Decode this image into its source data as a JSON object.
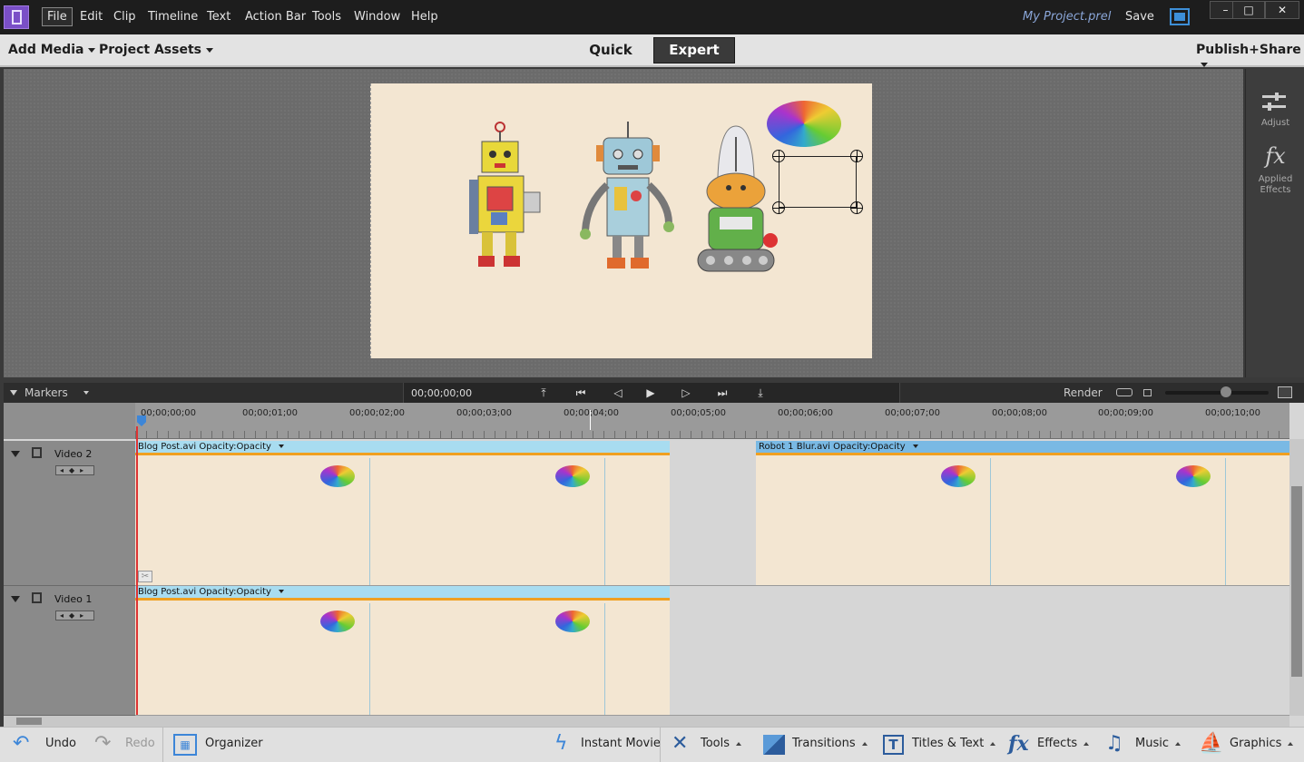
{
  "menu": {
    "items": [
      "File",
      "Edit",
      "Clip",
      "Timeline",
      "Text",
      "Action Bar",
      "Tools",
      "Window",
      "Help"
    ],
    "project_name": "My Project.prel",
    "save": "Save"
  },
  "window_controls": {
    "minimize": "–",
    "restore": "□",
    "close": "✕"
  },
  "modebar": {
    "add_media": "Add Media",
    "project_assets": "Project Assets",
    "quick": "Quick",
    "expert": "Expert",
    "publish_share": "Publish+Share",
    "active_mode": "Expert"
  },
  "right_panel": {
    "adjust": "Adjust",
    "fx_glyph": "fx",
    "applied_effects": "Applied Effects"
  },
  "transport": {
    "markers": "Markers",
    "timecode": "00;00;00;00",
    "render": "Render",
    "buttons": [
      "goto-in",
      "goto-start",
      "step-back",
      "play",
      "step-forward",
      "goto-end",
      "goto-out"
    ],
    "zoom_level": 0.6
  },
  "timeline": {
    "ruler": [
      "00;00;00;00",
      "00;00;01;00",
      "00;00;02;00",
      "00;00;03;00",
      "00;00;04;00",
      "00;00;05;00",
      "00;00;06;00",
      "00;00;07;00",
      "00;00;08;00",
      "00;00;09;00",
      "00;00;10;00"
    ],
    "tracks": [
      {
        "name": "Video 2",
        "clips": [
          {
            "label": "Blog Post.avi",
            "effect": "Opacity:Opacity"
          },
          {
            "label": "Robot 1 Blur.avi",
            "effect": "Opacity:Opacity"
          }
        ]
      },
      {
        "name": "Video 1",
        "clips": [
          {
            "label": "Blog Post.avi",
            "effect": "Opacity:Opacity"
          }
        ]
      }
    ]
  },
  "actionbar": {
    "undo": "Undo",
    "redo": "Redo",
    "organizer": "Organizer",
    "instant_movie": "Instant Movie",
    "tools": "Tools",
    "transitions": "Transitions",
    "titles_text": "Titles & Text",
    "effects": "Effects",
    "music": "Music",
    "graphics": "Graphics"
  },
  "colors": {
    "accent": "#3d86d8",
    "clip_bar": "#a8dcf0",
    "clip_bar_selected": "#79b9e4",
    "opacity_line": "#f0a020",
    "app_icon": "#7a4fc7"
  }
}
